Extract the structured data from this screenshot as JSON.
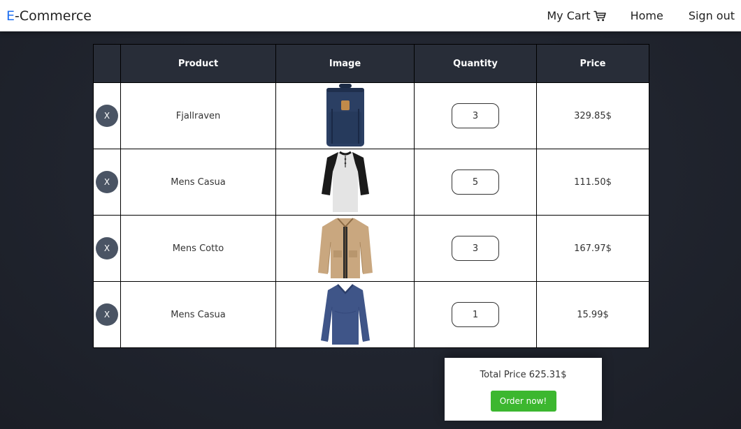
{
  "brand": {
    "prefix": "E",
    "rest": "-Commerce",
    "accent_color": "#1e6ff1"
  },
  "nav": {
    "cart_label": "My Cart",
    "cart_icon": "cart-icon",
    "home_label": "Home",
    "signout_label": "Sign out"
  },
  "table": {
    "headers": [
      "",
      "Product",
      "Image",
      "Quantity",
      "Price"
    ],
    "rows": [
      {
        "remove_label": "X",
        "product": "Fjallraven",
        "image": "backpack-image",
        "quantity": "3",
        "price": "329.85$"
      },
      {
        "remove_label": "X",
        "product": "Mens Casua",
        "image": "raglan-tshirt-image",
        "quantity": "5",
        "price": "111.50$"
      },
      {
        "remove_label": "X",
        "product": "Mens Cotto",
        "image": "jacket-image",
        "quantity": "3",
        "price": "167.97$"
      },
      {
        "remove_label": "X",
        "product": "Mens Casua",
        "image": "longsleeve-shirt-image",
        "quantity": "1",
        "price": "15.99$"
      }
    ]
  },
  "total": {
    "label": "Total Price 625.31$",
    "order_button": "Order now!",
    "button_color": "#3cb72f"
  }
}
